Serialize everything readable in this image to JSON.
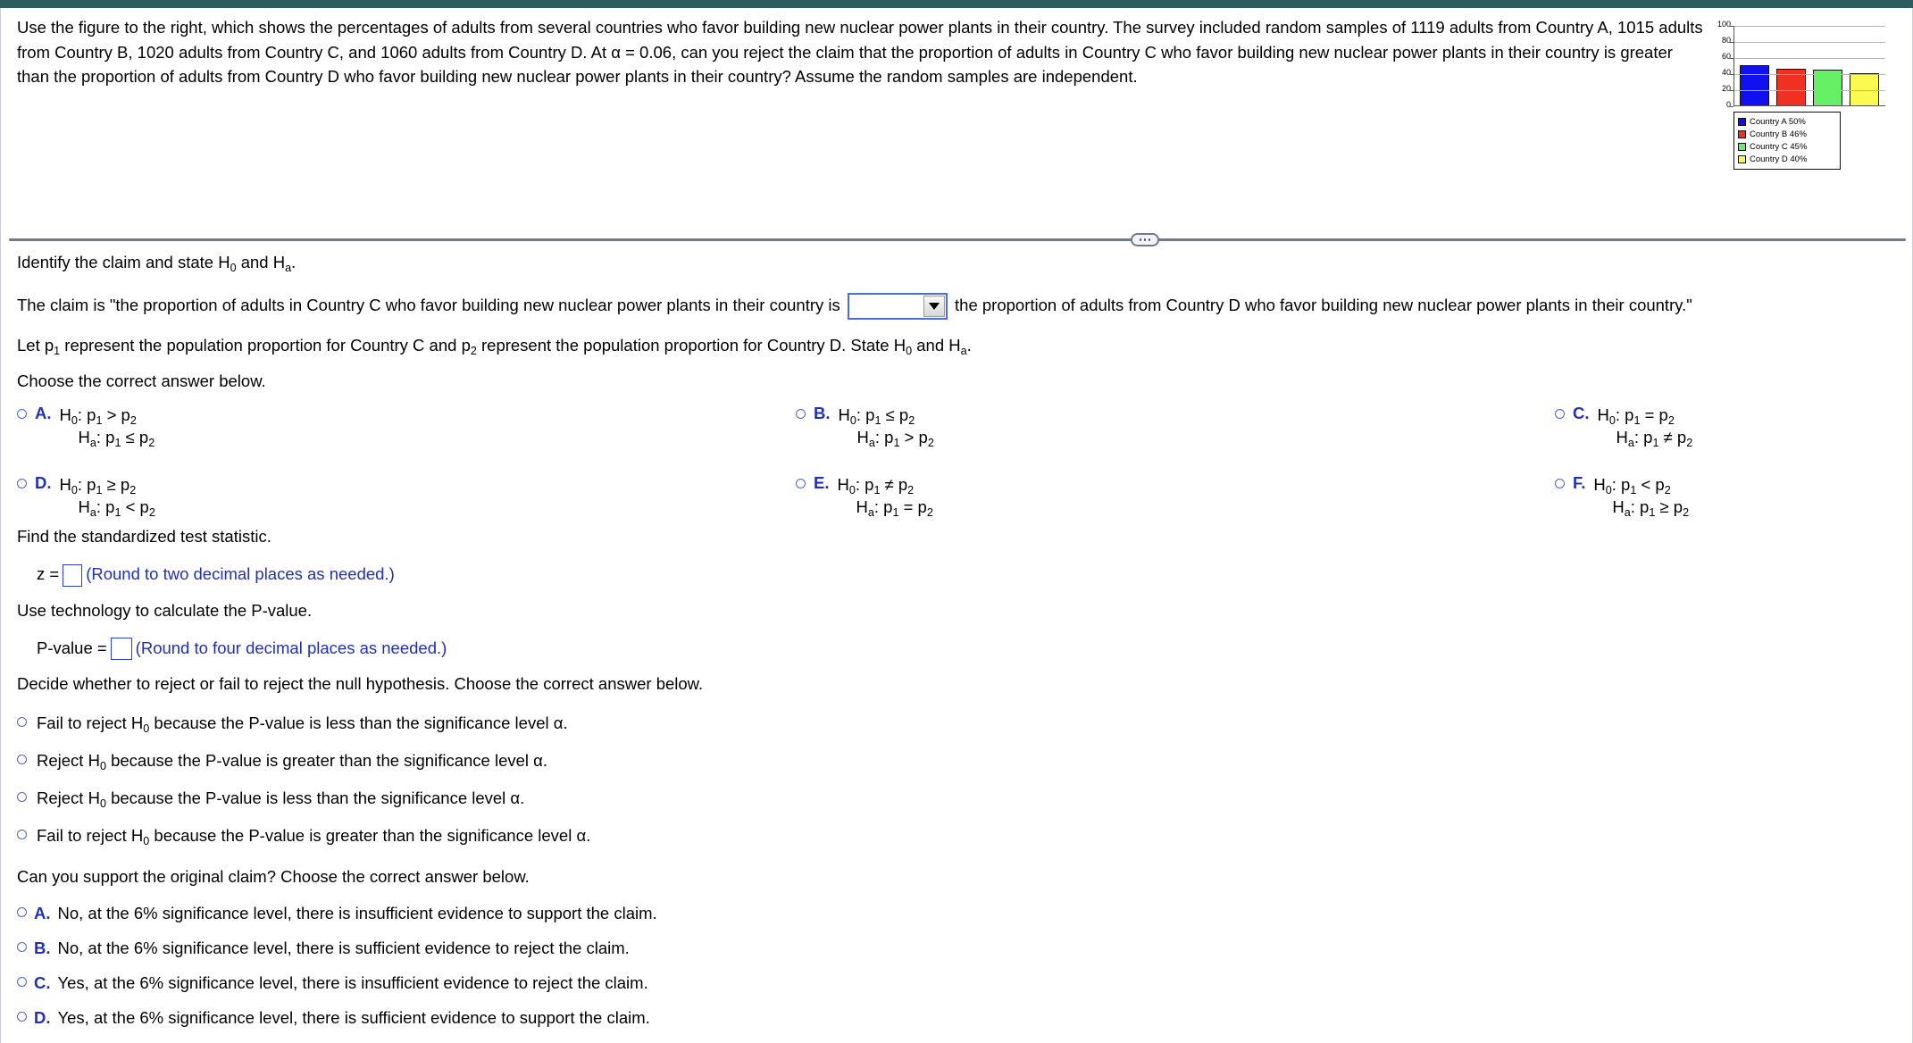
{
  "problem": {
    "statement": "Use the figure to the right, which shows the percentages of adults from several countries who favor building new nuclear power plants in their country. The survey included random samples of 1119 adults from Country A, 1015 adults from Country B, 1020 adults from Country C, and 1060 adults from Country D. At α = 0.06, can you reject the claim that the proportion of adults in Country C who favor building new nuclear power plants in their country is greater than the proportion of adults from Country D who favor building new nuclear power plants in their country? Assume the random samples are independent."
  },
  "chart_data": {
    "type": "bar",
    "title": "",
    "xlabel": "",
    "ylabel": "",
    "categories": [
      "Country A",
      "Country B",
      "Country C",
      "Country D"
    ],
    "values": [
      50,
      46,
      45,
      40
    ],
    "ylim": [
      0,
      100
    ],
    "yticks": [
      "100",
      "80",
      "60",
      "40",
      "20",
      "0"
    ],
    "grid": true,
    "legend_position": "below",
    "colors": [
      "#1010F0",
      "#F03020",
      "#66F066",
      "#FAFA50"
    ],
    "legend": [
      "Country A 50%",
      "Country B 46%",
      "Country C 45%",
      "Country D 40%"
    ]
  },
  "splitter": {
    "handle_label": "•••"
  },
  "workspace": {
    "identify_claim": {
      "pre": "Identify the claim and state H",
      "sub1": "0",
      "mid": " and H",
      "sub2": "a",
      "post": "."
    },
    "claim_sentence": {
      "before": "The claim is \"the proportion of adults in Country C who favor building new nuclear power plants in their country is",
      "after": "the proportion of adults from Country D who favor building new nuclear power plants in their country.\"",
      "dropdown_value": "",
      "dropdown_icon": "chevron-down-icon"
    },
    "let_p_sentence": {
      "part1": "Let p",
      "sub1": "1",
      "part2": " represent the population proportion for Country C and p",
      "sub2": "2",
      "part3": " represent the population proportion for Country D. State H",
      "sub3": "0",
      "part4": " and H",
      "sub4": "a",
      "part5": "."
    },
    "choose_answer_label": "Choose the correct answer below.",
    "hypothesis_options": [
      {
        "letter": "A.",
        "null": "H₀: p₁ > p₂",
        "alt": "Hₐ: p₁ ≤ p₂",
        "null_parts": [
          "H",
          "0",
          ": p",
          "1",
          " > p",
          "2"
        ],
        "alt_parts": [
          "H",
          "a",
          ": p",
          "1",
          " ≤ p",
          "2"
        ]
      },
      {
        "letter": "B.",
        "null": "H₀: p₁ ≤ p₂",
        "alt": "Hₐ: p₁ > p₂",
        "null_parts": [
          "H",
          "0",
          ": p",
          "1",
          " ≤ p",
          "2"
        ],
        "alt_parts": [
          "H",
          "a",
          ": p",
          "1",
          " > p",
          "2"
        ]
      },
      {
        "letter": "C.",
        "null": "H₀: p₁ = p₂",
        "alt": "Hₐ: p₁ ≠ p₂",
        "null_parts": [
          "H",
          "0",
          ": p",
          "1",
          " = p",
          "2"
        ],
        "alt_parts": [
          "H",
          "a",
          ": p",
          "1",
          " ≠ p",
          "2"
        ]
      },
      {
        "letter": "D.",
        "null": "H₀: p₁ ≥ p₂",
        "alt": "Hₐ: p₁ < p₂",
        "null_parts": [
          "H",
          "0",
          ": p",
          "1",
          " ≥ p",
          "2"
        ],
        "alt_parts": [
          "H",
          "a",
          ": p",
          "1",
          " < p",
          "2"
        ]
      },
      {
        "letter": "E.",
        "null": "H₀: p₁ ≠ p₂",
        "alt": "Hₐ: p₁ = p₂",
        "null_parts": [
          "H",
          "0",
          ": p",
          "1",
          " ≠ p",
          "2"
        ],
        "alt_parts": [
          "H",
          "a",
          ": p",
          "1",
          " = p",
          "2"
        ]
      },
      {
        "letter": "F.",
        "null": "H₀: p₁ < p₂",
        "alt": "Hₐ: p₁ ≥ p₂",
        "null_parts": [
          "H",
          "0",
          ": p",
          "1",
          " < p",
          "2"
        ],
        "alt_parts": [
          "H",
          "a",
          ": p",
          "1",
          " ≥ p",
          "2"
        ]
      }
    ],
    "test_statistic": {
      "prompt": "Find the standardized test statistic.",
      "label": "z =",
      "value": "",
      "hint": "(Round to two decimal places as needed.)"
    },
    "p_value": {
      "prompt": "Use technology to calculate the P-value.",
      "label": "P-value =",
      "value": "",
      "hint": "(Round to four decimal places as needed.)"
    },
    "decision": {
      "prompt": "Decide whether to reject or fail to reject the null hypothesis. Choose the correct answer below.",
      "options": [
        {
          "pre": "Fail to reject H",
          "sub": "0",
          "post": " because the P-value is less than the significance level α."
        },
        {
          "pre": "Reject H",
          "sub": "0",
          "post": " because the P-value is greater than the significance level α."
        },
        {
          "pre": "Reject H",
          "sub": "0",
          "post": " because the P-value is less than the significance level α."
        },
        {
          "pre": "Fail to reject H",
          "sub": "0",
          "post": " because the P-value is greater than the significance level α."
        }
      ]
    },
    "conclusion": {
      "prompt": "Can you support the original claim? Choose the correct answer below.",
      "options": [
        {
          "letter": "A.",
          "text": "No, at the 6% significance level, there is insufficient evidence to support the claim."
        },
        {
          "letter": "B.",
          "text": "No, at the 6% significance level, there is sufficient evidence to reject the claim."
        },
        {
          "letter": "C.",
          "text": "Yes, at the 6% significance level, there is insufficient evidence to reject the claim."
        },
        {
          "letter": "D.",
          "text": "Yes, at the 6% significance level, there is sufficient evidence to support the claim."
        }
      ]
    }
  }
}
